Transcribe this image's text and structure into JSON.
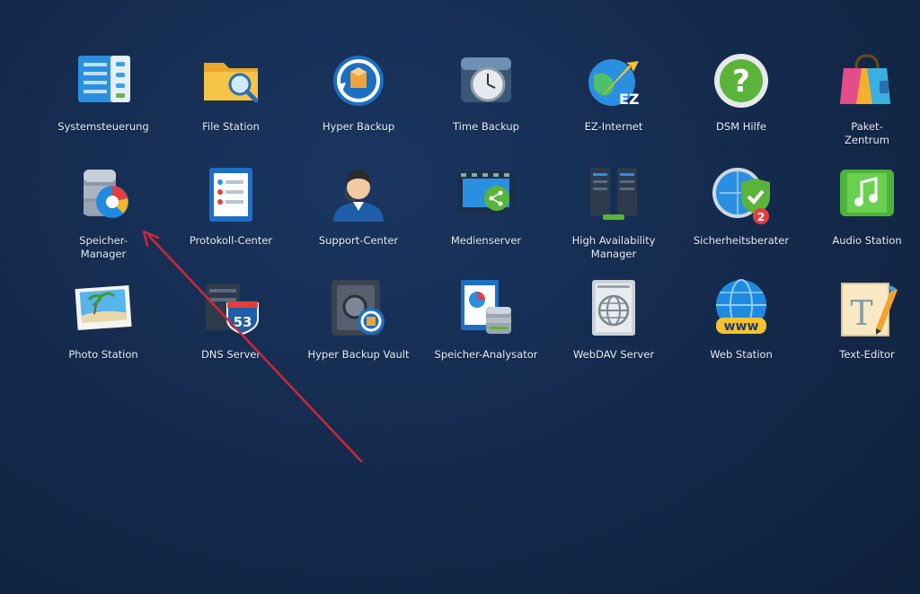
{
  "desktop": {
    "apps": [
      {
        "label": "Systemsteuerung",
        "icon": "control-panel-icon"
      },
      {
        "label": "File Station",
        "icon": "folder-search-icon"
      },
      {
        "label": "Hyper Backup",
        "icon": "hyper-backup-icon"
      },
      {
        "label": "Time Backup",
        "icon": "time-backup-icon"
      },
      {
        "label": "EZ-Internet",
        "icon": "ez-internet-icon"
      },
      {
        "label": "DSM Hilfe",
        "icon": "help-icon"
      },
      {
        "label": "Paket-\nZentrum",
        "icon": "package-center-icon"
      },
      {
        "label": "Speicher-\nManager",
        "icon": "storage-manager-icon"
      },
      {
        "label": "Protokoll-Center",
        "icon": "log-center-icon"
      },
      {
        "label": "Support-Center",
        "icon": "support-center-icon"
      },
      {
        "label": "Medienserver",
        "icon": "media-server-icon"
      },
      {
        "label": "High Availability Manager",
        "icon": "high-availability-icon"
      },
      {
        "label": "Sicherheitsberater",
        "icon": "security-advisor-icon",
        "badge": "2"
      },
      {
        "label": "Audio Station",
        "icon": "audio-station-icon"
      },
      {
        "label": "Photo Station",
        "icon": "photo-station-icon"
      },
      {
        "label": "DNS Server",
        "icon": "dns-server-icon",
        "badge_text": "53"
      },
      {
        "label": "Hyper Backup Vault",
        "icon": "hyper-backup-vault-icon"
      },
      {
        "label": "Speicher-Analysator",
        "icon": "storage-analyzer-icon"
      },
      {
        "label": "WebDAV Server",
        "icon": "webdav-server-icon"
      },
      {
        "label": "Web Station",
        "icon": "web-station-icon",
        "badge_text": "www"
      },
      {
        "label": "Text-Editor",
        "icon": "text-editor-icon"
      }
    ]
  },
  "colors": {
    "background": "#14294b",
    "label_text": "#e8eef7",
    "arrow": "#d0263a"
  }
}
